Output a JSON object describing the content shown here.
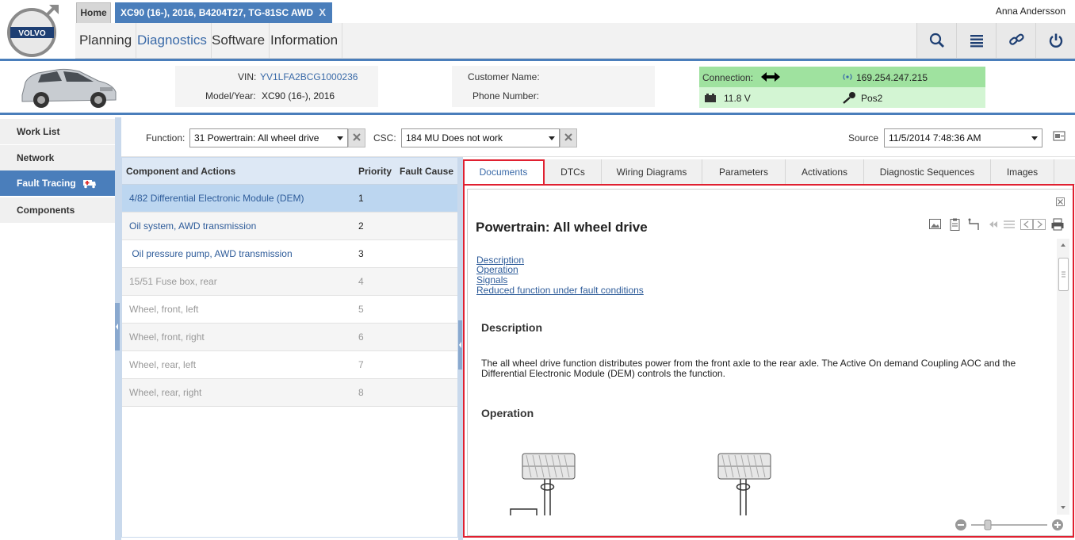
{
  "header": {
    "brand": "VOLVO",
    "tabs": {
      "home": "Home",
      "vehicle": "XC90 (16-), 2016, B4204T27, TG-81SC AWD",
      "close": "X"
    },
    "menu": [
      "Planning",
      "Diagnostics",
      "Software",
      "Information"
    ],
    "active_menu": "Diagnostics",
    "user": "Anna Andersson",
    "tools": [
      "search-icon",
      "list-icon",
      "link-icon",
      "power-icon"
    ]
  },
  "vehicle": {
    "vin_label": "VIN:",
    "vin": "YV1LFA2BCG1000236",
    "model_label": "Model/Year:",
    "model": "XC90 (16-), 2016",
    "customer_label": "Customer Name:",
    "phone_label": "Phone Number:",
    "connection_label": "Connection:",
    "ip": "169.254.247.215",
    "voltage": "11.8 V",
    "ignition": "Pos2"
  },
  "sidenav": {
    "items": [
      "Work List",
      "Network",
      "Fault Tracing",
      "Components"
    ],
    "active": "Fault Tracing"
  },
  "filters": {
    "function_label": "Function:",
    "function_value": "31 Powertrain: All wheel drive",
    "csc_label": "CSC:",
    "csc_value": "184 MU Does not work",
    "source_label": "Source",
    "source_value": "11/5/2014 7:48:36 AM"
  },
  "components": {
    "headers": {
      "name": "Component and Actions",
      "priority": "Priority",
      "cause": "Fault Cause"
    },
    "rows": [
      {
        "name": "4/82 Differential Electronic Module (DEM)",
        "priority": "1"
      },
      {
        "name": "Oil system, AWD transmission",
        "priority": "2"
      },
      {
        "name": " Oil pressure pump, AWD transmission",
        "priority": "3"
      },
      {
        "name": "15/51 Fuse box, rear",
        "priority": "4"
      },
      {
        "name": "Wheel, front, left",
        "priority": "5"
      },
      {
        "name": "Wheel, front, right",
        "priority": "6"
      },
      {
        "name": "Wheel, rear, left",
        "priority": "7"
      },
      {
        "name": "Wheel, rear, right",
        "priority": "8"
      }
    ]
  },
  "document": {
    "tabs": [
      "Documents",
      "DTCs",
      "Wiring Diagrams",
      "Parameters",
      "Activations",
      "Diagnostic Sequences",
      "Images"
    ],
    "active_tab": "Documents",
    "title": "Powertrain: All wheel drive",
    "toc": [
      "Description",
      "Operation",
      "Signals",
      "Reduced function under fault conditions"
    ],
    "sections": {
      "description_heading": "Description",
      "description_text": "The all wheel drive function distributes power from the front axle to the rear axle. The Active On demand Coupling AOC and the Differential Electronic Module (DEM) controls the function.",
      "operation_heading": "Operation"
    },
    "colors": {
      "accent": "#4a7ebb",
      "highlight": "#e02030",
      "connection": "#9fe29f"
    }
  }
}
